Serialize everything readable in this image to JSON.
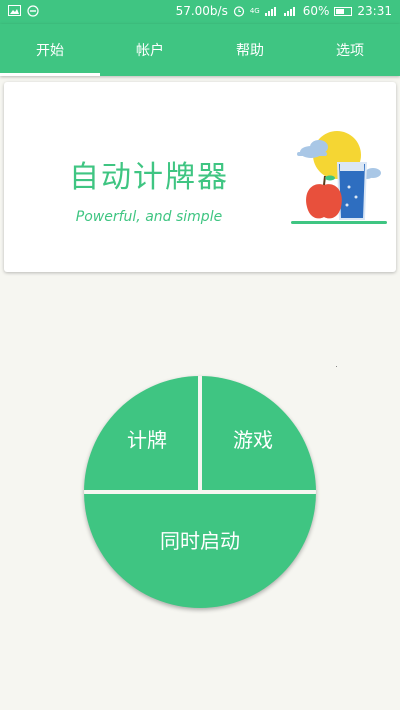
{
  "status_bar": {
    "speed": "57.00b/s",
    "network": "4G",
    "battery": "60%",
    "battery_level": 0.6,
    "time": "23:31"
  },
  "tabs": [
    {
      "label": "开始",
      "active": true
    },
    {
      "label": "帐户",
      "active": false
    },
    {
      "label": "帮助",
      "active": false
    },
    {
      "label": "选项",
      "active": false
    }
  ],
  "banner": {
    "title": "自动计牌器",
    "subtitle": "Powerful, and simple"
  },
  "wheel": {
    "top_left": "计牌",
    "top_right": "游戏",
    "bottom": "同时启动"
  },
  "colors": {
    "primary": "#3fc582",
    "background": "#f6f6f1",
    "sun": "#f5d633",
    "apple": "#e8503c",
    "glass": "#2e6ec0"
  }
}
